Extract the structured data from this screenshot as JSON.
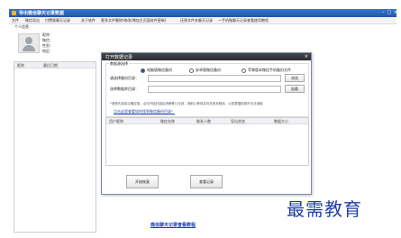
{
  "window": {
    "title": "导出微信聊天记录数据",
    "controls": [
      "–",
      "□",
      "×"
    ]
  },
  "menu": [
    "文件",
    "微信导出",
    "付费版聊天记录",
    "关于软件",
    "更多文件删除/修改(增加主页面软件更新)",
    "还原文件夹聊天记录",
    "一手机微聊天记录查看使用教程"
  ],
  "user": {
    "header": "个人信息",
    "fields": [
      "昵称：",
      "微信：",
      "性别：",
      "地区："
    ]
  },
  "left_list": {
    "columns": [
      "昵称",
      "最后日期"
    ]
  },
  "bottom_link": "微信聊天记录查看教程",
  "dialog": {
    "title": "打开数据记录",
    "close": "×",
    "group_label": "数据源选择",
    "radios": [
      {
        "label": "电脑版微信备份",
        "selected": true
      },
      {
        "label": "安卓版微信备份",
        "selected": false
      },
      {
        "label": "苹果版本微信手机备份文件",
        "selected": false
      }
    ],
    "rows": [
      {
        "label": "请选择备份目录：",
        "value": "",
        "button": "浏览"
      },
      {
        "label": "选择数据库目录：",
        "value": "",
        "button": "加载"
      }
    ],
    "note": "*请首先选择正确目录，点击开始扫描后请稍等几分钟，请耐心等待并勿关闭本程序，以防数据库损坏无法读取",
    "help_link": "点击这里查看如何找到微信备份目录！",
    "table_columns": [
      "用户昵称",
      "微信名称",
      "联系人数",
      "导出状态",
      "数据大小"
    ],
    "buttons": [
      "开始恢复",
      "查看记录"
    ]
  },
  "watermark": "最需教育"
}
